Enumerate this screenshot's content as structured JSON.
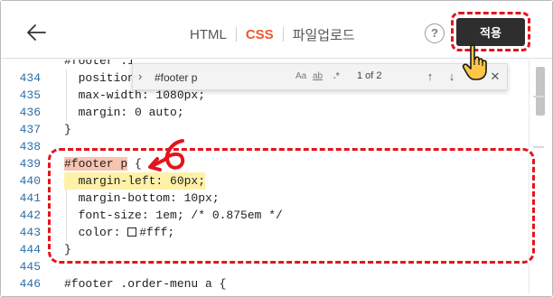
{
  "header": {
    "tabs": [
      {
        "label": "HTML",
        "active": false
      },
      {
        "label": "CSS",
        "active": true
      },
      {
        "label": "파일업로드",
        "active": false
      }
    ],
    "help_label": "?",
    "apply_label": "적용"
  },
  "find": {
    "query": "#footer p",
    "options": {
      "match_case": "Aa",
      "whole_word": "ab",
      "regex": ".*"
    },
    "count": "1 of 2"
  },
  "editor": {
    "lines": [
      {
        "n": "434",
        "text": "  position: relative;"
      },
      {
        "n": "435",
        "text": "  max-width: 1080px;"
      },
      {
        "n": "436",
        "text": "  margin: 0 auto;"
      },
      {
        "n": "437",
        "text": "}"
      },
      {
        "n": "438",
        "text": ""
      },
      {
        "n": "439",
        "selector": "#footer p",
        "text": " {"
      },
      {
        "n": "440",
        "text": "  margin-left: 60px;"
      },
      {
        "n": "441",
        "text": "  margin-bottom: 10px;"
      },
      {
        "n": "442",
        "text": "  font-size: 1em; /* 0.875em */"
      },
      {
        "n": "443",
        "text": "  color: #fff;"
      },
      {
        "n": "444",
        "text": "}"
      },
      {
        "n": "445",
        "text": ""
      },
      {
        "n": "446",
        "text": "#footer .order-menu a {"
      }
    ],
    "partial_top": "#footer .i"
  },
  "colors": {
    "accent": "#f1562b",
    "annotation_red": "#e5141c",
    "apply_bg": "#2e2e2e",
    "line_number": "#2b6fa8",
    "highlight_yellow": "#fff2a8",
    "selection_red": "#f8c4b0"
  }
}
